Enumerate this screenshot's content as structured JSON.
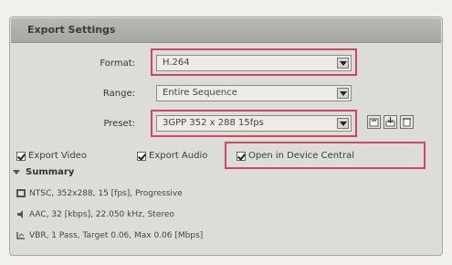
{
  "panel": {
    "title": "Export Settings"
  },
  "format": {
    "label": "Format:",
    "value": "H.264"
  },
  "range": {
    "label": "Range:",
    "value": "Entire Sequence"
  },
  "preset": {
    "label": "Preset:",
    "value": "3GPP 352 x 288 15fps"
  },
  "checkboxes": {
    "export_video": "Export Video",
    "export_audio": "Export Audio",
    "open_device_central": "Open in Device Central"
  },
  "summary": {
    "heading": "Summary",
    "video": "NTSC, 352x288, 15 [fps], Progressive",
    "audio": "AAC, 32 [kbps], 22.050 kHz, Stereo",
    "bitrate": "VBR, 1 Pass, Target 0.06, Max 0.06 [Mbps]"
  },
  "colors": {
    "highlight": "#d2455c",
    "panel_bg": "#dcdcd8",
    "header_bg": "#a7a7a2"
  },
  "icons": [
    "save-preset-icon",
    "import-preset-icon",
    "delete-preset-icon",
    "film-icon",
    "audio-icon",
    "bitrate-icon"
  ]
}
